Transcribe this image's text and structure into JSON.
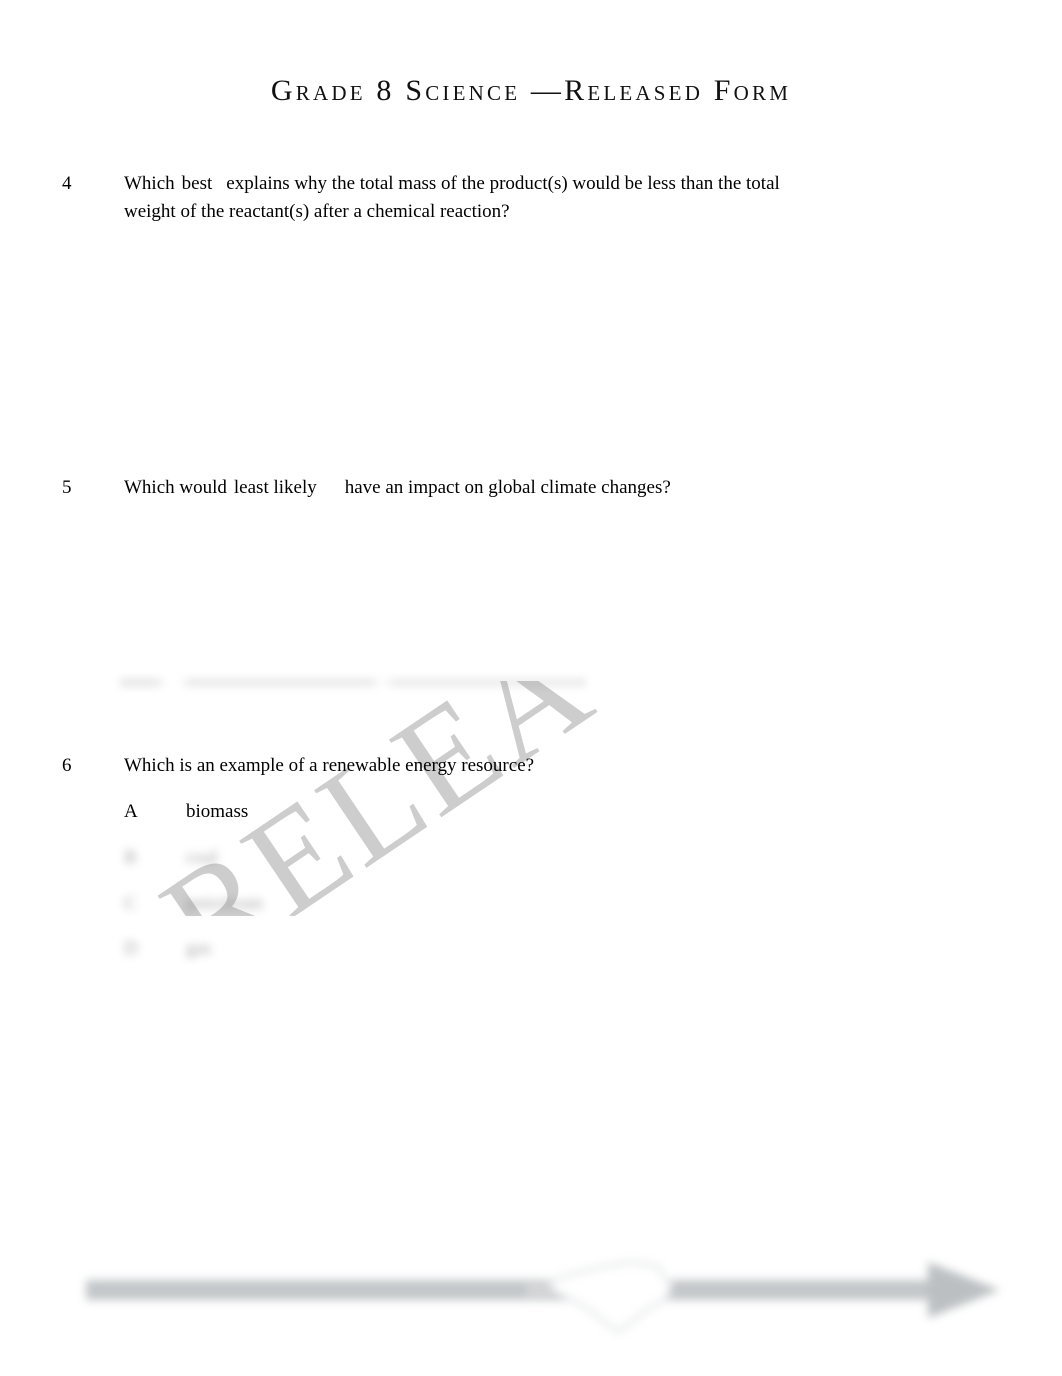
{
  "document": {
    "title": "Grade 8 Science —Released Form",
    "watermark_text": "RELEA",
    "page_background": "#ffffff",
    "text_color": "#000000",
    "watermark_color": "#cdcdcd",
    "footer_graphic_color": "#b9bdc0"
  },
  "questions": [
    {
      "number": "4",
      "text_part1": "Which",
      "text_emphasis": "best",
      "text_part2": "explains why the total mass of the product(s) would be less than the total weight of the reactant(s) after a chemical reaction?",
      "options": []
    },
    {
      "number": "5",
      "text_part1": "Which would",
      "text_emphasis": "least likely",
      "text_part2": "have an impact on global climate changes?",
      "options": []
    },
    {
      "number": "6",
      "text_part1": "Which is an example of a renewable energy resource?",
      "text_emphasis": "",
      "text_part2": "",
      "options": [
        {
          "letter": "A",
          "text": "biomass",
          "redacted": false
        },
        {
          "letter": "B",
          "text": "coal",
          "redacted": true
        },
        {
          "letter": "C",
          "text": "petroleum",
          "redacted": true
        },
        {
          "letter": "D",
          "text": "gas",
          "redacted": true
        }
      ]
    }
  ],
  "footer": {
    "graphic_name": "north-carolina-arrow-banner"
  }
}
